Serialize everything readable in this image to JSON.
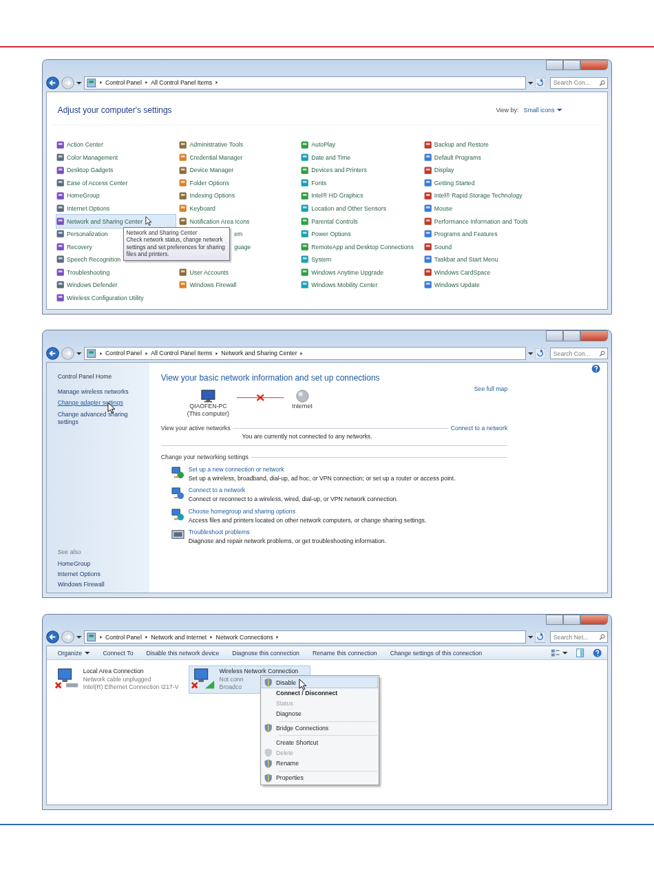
{
  "windows": [
    {
      "kind": "control_panel",
      "breadcrumb": [
        "Control Panel",
        "All Control Panel Items"
      ],
      "search": {
        "placeholder": "Search Con..."
      },
      "heading": "Adjust your computer's settings",
      "view_by": {
        "label": "View by:",
        "value": "Small icons"
      },
      "rows": [
        [
          {
            "label": "Action Center",
            "kind": "link",
            "selected": false
          },
          {
            "label": "Administrative Tools",
            "kind": "link",
            "selected": false
          },
          {
            "label": "AutoPlay",
            "kind": "link",
            "selected": false
          },
          {
            "label": "Backup and Restore",
            "kind": "link",
            "selected": false
          }
        ],
        [
          {
            "label": "Color Management",
            "kind": "link",
            "selected": false
          },
          {
            "label": "Credential Manager",
            "kind": "link",
            "selected": false
          },
          {
            "label": "Date and Time",
            "kind": "link",
            "selected": false
          },
          {
            "label": "Default Programs",
            "kind": "link",
            "selected": false
          }
        ],
        [
          {
            "label": "Desktop Gadgets",
            "kind": "link",
            "selected": false
          },
          {
            "label": "Device Manager",
            "kind": "link",
            "selected": false
          },
          {
            "label": "Devices and Printers",
            "kind": "link",
            "selected": false
          },
          {
            "label": "Display",
            "kind": "link",
            "selected": false
          }
        ],
        [
          {
            "label": "Ease of Access Center",
            "kind": "link",
            "selected": false
          },
          {
            "label": "Folder Options",
            "kind": "link",
            "selected": false
          },
          {
            "label": "Fonts",
            "kind": "link",
            "selected": false
          },
          {
            "label": "Getting Started",
            "kind": "link",
            "selected": false
          }
        ],
        [
          {
            "label": "HomeGroup",
            "kind": "link",
            "selected": false
          },
          {
            "label": "Indexing Options",
            "kind": "link",
            "selected": false
          },
          {
            "label": "Intel® HD Graphics",
            "kind": "link",
            "selected": false
          },
          {
            "label": "Intel® Rapid Storage Technology",
            "kind": "link",
            "selected": false
          }
        ],
        [
          {
            "label": "Internet Options",
            "kind": "link",
            "selected": false
          },
          {
            "label": "Keyboard",
            "kind": "link",
            "selected": false
          },
          {
            "label": "Location and Other Sensors",
            "kind": "link",
            "selected": false
          },
          {
            "label": "Mouse",
            "kind": "link",
            "selected": false
          }
        ],
        [
          {
            "label": "Network and Sharing Center",
            "kind": "link",
            "selected": true
          },
          {
            "label": "Notification Area Icons",
            "kind": "link",
            "selected": false
          },
          {
            "label": "Parental Controls",
            "kind": "link",
            "selected": false
          },
          {
            "label": "Performance Information and Tools",
            "kind": "link",
            "selected": false
          }
        ],
        [
          {
            "label": "Personalization",
            "kind": "link",
            "selected": false
          },
          {
            "label": "em",
            "kind": "partial",
            "selected": false
          },
          {
            "label": "Power Options",
            "kind": "link",
            "selected": false
          },
          {
            "label": "Programs and Features",
            "kind": "link",
            "selected": false
          }
        ],
        [
          {
            "label": "Recovery",
            "kind": "link",
            "selected": false
          },
          {
            "label": "guage",
            "kind": "partial",
            "selected": false
          },
          {
            "label": "RemoteApp and Desktop Connections",
            "kind": "link",
            "selected": false
          },
          {
            "label": "Sound",
            "kind": "link",
            "selected": false
          }
        ],
        [
          {
            "label": "Speech Recognition",
            "kind": "link",
            "selected": false
          },
          null,
          {
            "label": "System",
            "kind": "link",
            "selected": false
          },
          {
            "label": "Taskbar and Start Menu",
            "kind": "link",
            "selected": false
          }
        ],
        [
          {
            "label": "Troubleshooting",
            "kind": "link",
            "selected": false
          },
          {
            "label": "User Accounts",
            "kind": "link",
            "selected": false
          },
          {
            "label": "Windows Anytime Upgrade",
            "kind": "link",
            "selected": false
          },
          {
            "label": "Windows CardSpace",
            "kind": "link",
            "selected": false
          }
        ],
        [
          {
            "label": "Windows Defender",
            "kind": "link",
            "selected": false
          },
          {
            "label": "Windows Firewall",
            "kind": "link",
            "selected": false
          },
          {
            "label": "Windows Mobility Center",
            "kind": "link",
            "selected": false
          },
          {
            "label": "Windows Update",
            "kind": "link",
            "selected": false
          }
        ],
        [
          {
            "label": "Wireless Configuration Utility",
            "kind": "link",
            "selected": false
          }
        ]
      ],
      "tooltip": {
        "title": "Network and Sharing Center",
        "text": "Check network status, change network settings and set preferences for sharing files and printers."
      }
    },
    {
      "kind": "network_center",
      "breadcrumb": [
        "Control Panel",
        "All Control Panel Items",
        "Network and Sharing Center"
      ],
      "search": {
        "placeholder": "Search Con..."
      },
      "sidebar": {
        "home": "Control Panel Home",
        "links": [
          {
            "label": "Manage wireless networks",
            "hovered": false
          },
          {
            "label": "Change adapter settings",
            "hovered": true
          },
          {
            "label": "Change advanced sharing settings",
            "hovered": false
          }
        ],
        "see_also": {
          "title": "See also",
          "links": [
            "HomeGroup",
            "Internet Options",
            "Windows Firewall"
          ]
        }
      },
      "heading": "View your basic network information and set up connections",
      "full_map_link": "See full map",
      "map": {
        "computer": {
          "name": "QIAOFEN-PC",
          "note": "(This computer)"
        },
        "internet": "Internet",
        "connected": false
      },
      "active_networks": {
        "title": "View your active networks",
        "link": "Connect to a network",
        "message": "You are currently not connected to any networks."
      },
      "settings": {
        "title": "Change your networking settings",
        "tasks": [
          {
            "kind": "new_connection",
            "title": "Set up a new connection or network",
            "description": "Set up a wireless, broadband, dial-up, ad hoc, or VPN connection; or set up a router or access point."
          },
          {
            "kind": "connect",
            "title": "Connect to a network",
            "description": "Connect or reconnect to a wireless, wired, dial-up, or VPN network connection."
          },
          {
            "kind": "homegroup",
            "title": "Choose homegroup and sharing options",
            "description": "Access files and printers located on other network computers, or change sharing settings."
          },
          {
            "kind": "troubleshoot",
            "title": "Troubleshoot problems",
            "description": "Diagnose and repair network problems, or get troubleshooting information."
          }
        ]
      }
    },
    {
      "kind": "network_connections",
      "breadcrumb": [
        "Control Panel",
        "Network and Internet",
        "Network Connections"
      ],
      "search": {
        "placeholder": "Search Net..."
      },
      "toolbar": [
        {
          "label": "Organize",
          "menu": true
        },
        {
          "label": "Connect To",
          "menu": false
        },
        {
          "label": "Disable this network device",
          "menu": false
        },
        {
          "label": "Diagnose this connection",
          "menu": false
        },
        {
          "label": "Rename this connection",
          "menu": false
        },
        {
          "label": "Change settings of this connection",
          "menu": false
        }
      ],
      "connections": [
        {
          "kind": "wired",
          "name": "Local Area Connection",
          "status": "Network cable unplugged",
          "device": "Intel(R) Ethernet Connection I217-V",
          "selected": false,
          "connected": false
        },
        {
          "kind": "wireless",
          "name": "Wireless Network Connection",
          "status": "Not conn",
          "device": "Broadco",
          "selected": true,
          "connected": false
        }
      ],
      "context_menu": [
        {
          "label": "Disable",
          "shield": true,
          "selected": true,
          "disabled": false,
          "default": false,
          "separator_before": false
        },
        {
          "label": "Connect / Disconnect",
          "shield": false,
          "selected": false,
          "disabled": false,
          "default": true,
          "separator_before": false
        },
        {
          "label": "Status",
          "shield": false,
          "selected": false,
          "disabled": true,
          "default": false,
          "separator_before": false
        },
        {
          "label": "Diagnose",
          "shield": false,
          "selected": false,
          "disabled": false,
          "default": false,
          "separator_before": false
        },
        {
          "label": "Bridge Connections",
          "shield": true,
          "selected": false,
          "disabled": false,
          "default": false,
          "separator_before": true
        },
        {
          "label": "Create Shortcut",
          "shield": false,
          "selected": false,
          "disabled": false,
          "default": false,
          "separator_before": true
        },
        {
          "label": "Delete",
          "shield": true,
          "selected": false,
          "disabled": true,
          "default": false,
          "separator_before": false
        },
        {
          "label": "Rename",
          "shield": true,
          "selected": false,
          "disabled": false,
          "default": false,
          "separator_before": false
        },
        {
          "label": "Properties",
          "shield": true,
          "selected": false,
          "disabled": false,
          "default": false,
          "separator_before": true
        }
      ]
    }
  ]
}
